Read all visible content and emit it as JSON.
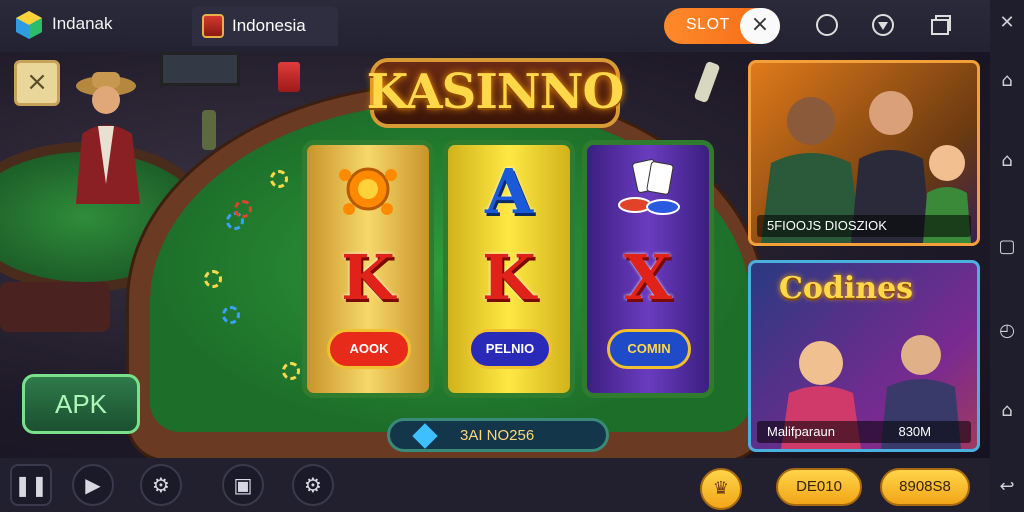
{
  "topbar": {
    "app_name": "Indanak",
    "tab_label": "Indonesia",
    "slot_label": "SLOT",
    "slot_close": "×"
  },
  "game": {
    "title": "KASINNO",
    "reels": [
      {
        "top_symbol": "sun",
        "middle": "K",
        "bottom_badge": "AOOK"
      },
      {
        "top_symbol": "A",
        "middle": "K",
        "bottom_badge": "PELNIO"
      },
      {
        "top_symbol": "chips",
        "middle": "X",
        "bottom_badge": "COMIN"
      }
    ],
    "info_bar": "3AI NO256",
    "apk_label": "APK",
    "close_badge": "×"
  },
  "cards": [
    {
      "caption": "5FIOOJS DIOSZIOK"
    },
    {
      "title": "Codines",
      "caption_left": "Malifparaun",
      "caption_right": "830M"
    }
  ],
  "bottombar": {
    "pill_left": "DE010",
    "pill_right": "8908S8"
  },
  "colors": {
    "accent_orange": "#f46a16",
    "felt_green": "#1d6e29",
    "gold": "#ffd84a"
  }
}
